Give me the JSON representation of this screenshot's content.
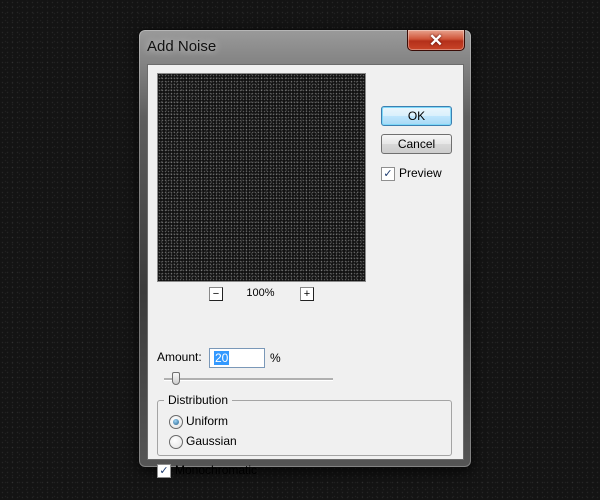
{
  "dialog": {
    "title": "Add Noise",
    "close_glyph": "✕",
    "preview": {
      "zoom_out_glyph": "−",
      "zoom_in_glyph": "+",
      "zoom_level": "100%"
    },
    "buttons": {
      "ok_label": "OK",
      "cancel_label": "Cancel"
    },
    "preview_toggle": {
      "label": "Preview",
      "checked": true,
      "check_glyph": "✓"
    },
    "amount": {
      "label": "Amount:",
      "value": "20",
      "unit": "%"
    },
    "distribution": {
      "legend": "Distribution",
      "options": [
        {
          "label": "Uniform",
          "selected": true
        },
        {
          "label": "Gaussian",
          "selected": false
        }
      ]
    },
    "monochromatic": {
      "label": "Monochromatic",
      "checked": true,
      "check_glyph": "✓"
    }
  }
}
